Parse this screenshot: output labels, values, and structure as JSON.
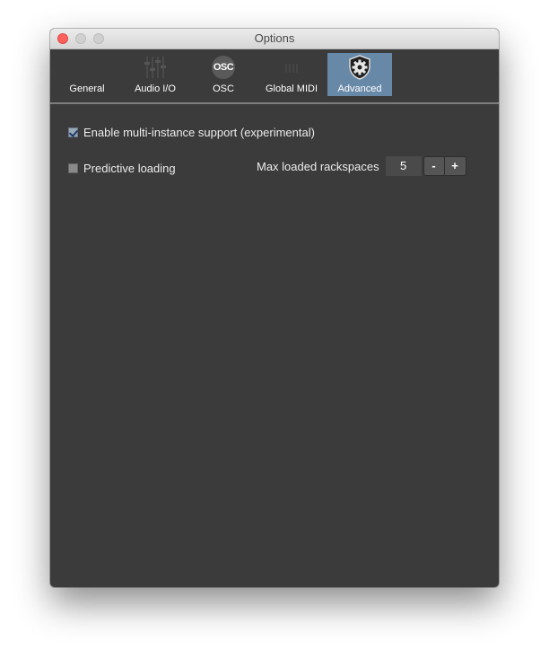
{
  "window": {
    "title": "Options"
  },
  "tabs": [
    {
      "label": "General",
      "icon": "general-icon",
      "active": false
    },
    {
      "label": "Audio I/O",
      "icon": "audio-faders-icon",
      "active": false
    },
    {
      "label": "OSC",
      "icon": "osc-icon",
      "icon_text": "OSC",
      "active": false
    },
    {
      "label": "Global MIDI",
      "icon": "midi-icon",
      "active": false
    },
    {
      "label": "Advanced",
      "icon": "gear-shield-icon",
      "active": true
    }
  ],
  "advanced": {
    "multi_instance": {
      "label": "Enable multi-instance support (experimental)",
      "checked": true
    },
    "predictive_loading": {
      "label": "Predictive loading",
      "checked": false
    },
    "max_rackspaces": {
      "label": "Max loaded rackspaces",
      "value": "5",
      "minus_label": "-",
      "plus_label": "+"
    }
  },
  "colors": {
    "window_bg": "#3b3b3b",
    "active_tab": "#6888a8",
    "text": "#ececec"
  }
}
